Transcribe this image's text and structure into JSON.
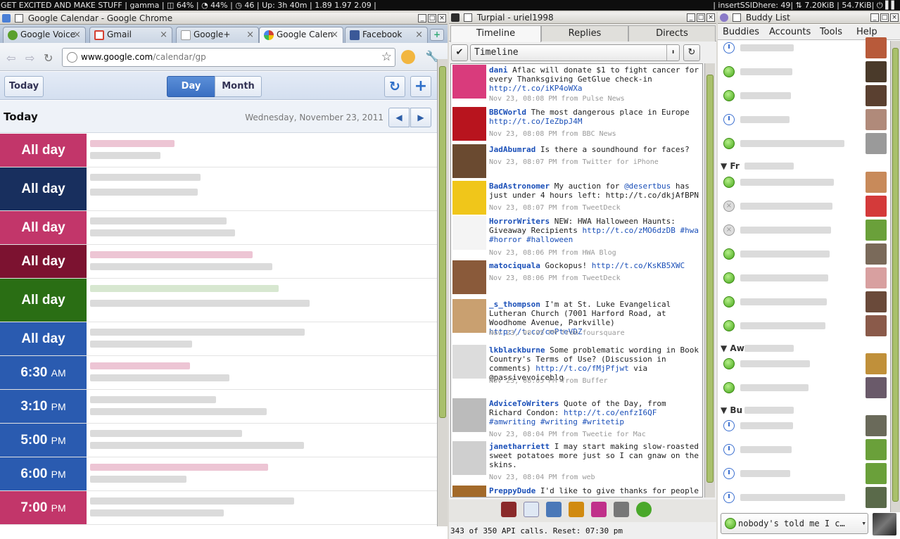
{
  "statusbar": {
    "left": "GET EXCITED AND MAKE STUFF | gamma | ◫ 64% | ◔ 44% | ◷ 46 | Up: 3h 40m | 1.89 1.97 2.09 |",
    "right": "| insertSSIDhere: 49| ⇅ 7.20KiB | 54.7KiB| ⏻ ▌▌"
  },
  "chrome": {
    "window_title": "Google Calendar - Google Chrome",
    "tabs": [
      {
        "label": "Google Voice",
        "color": "#5aa02c"
      },
      {
        "label": "Gmail",
        "color": "#d44032"
      },
      {
        "label": "Google+",
        "color": "#e6e6e6"
      },
      {
        "label": "Google Calen",
        "color": "#4a7fd6"
      },
      {
        "label": "Facebook",
        "color": "#3b5998"
      }
    ],
    "new_tab": "+",
    "url_host": "www.google.com",
    "url_path": "/calendar/gp"
  },
  "calendar": {
    "today_button": "Today",
    "day_button": "Day",
    "month_button": "Month",
    "refresh_glyph": "↻",
    "add_glyph": "+",
    "today_label": "Today",
    "date_label": "Wednesday, November 23, 2011",
    "prev_glyph": "◀",
    "next_glyph": "▶",
    "events": [
      {
        "time": "All day",
        "ampm": "",
        "color": "#c2366a",
        "height": 48
      },
      {
        "time": "All day",
        "ampm": "",
        "color": "#182f5e",
        "height": 62
      },
      {
        "time": "All day",
        "ampm": "",
        "color": "#c2366a",
        "height": 48
      },
      {
        "time": "All day",
        "ampm": "",
        "color": "#7c1230",
        "height": 48
      },
      {
        "time": "All day",
        "ampm": "",
        "color": "#2a6e14",
        "height": 62
      },
      {
        "time": "All day",
        "ampm": "",
        "color": "#2a5bb0",
        "height": 48
      },
      {
        "time": "6:30",
        "ampm": "AM",
        "color": "#2a5bb0",
        "height": 48
      },
      {
        "time": "3:10",
        "ampm": "PM",
        "color": "#2a5bb0",
        "height": 48
      },
      {
        "time": "5:00",
        "ampm": "PM",
        "color": "#2a5bb0",
        "height": 48
      },
      {
        "time": "6:00",
        "ampm": "PM",
        "color": "#2a5bb0",
        "height": 48
      },
      {
        "time": "7:00",
        "ampm": "PM",
        "color": "#c2366a",
        "height": 48
      }
    ]
  },
  "turpial": {
    "window_title": "Turpial - uriel1998",
    "tabs": [
      "Timeline",
      "Replies",
      "Directs"
    ],
    "column_select": "Timeline",
    "status_line": "343 of 350 API calls. Reset: 07:30 pm",
    "tweets": [
      {
        "user": "dani",
        "pre": "Aflac will donate $1 to fight cancer for every Thanksgiving GetGlue check-in ",
        "link": "http://t.co/iKP4oWXa",
        "post": "",
        "meta": "Nov 23, 08:08 PM from Pulse News",
        "av": "#d93b7c"
      },
      {
        "user": "BBCWorld",
        "pre": "The most dangerous place in Europe ",
        "link": "http://t.co/IeZbpJ4M",
        "post": "",
        "meta": "Nov 23, 08:08 PM from BBC News",
        "av": "#b8141e"
      },
      {
        "user": "JadAbumrad",
        "pre": "Is there a soundhound for faces?",
        "link": "",
        "post": "",
        "meta": "Nov 23, 08:07 PM from Twitter for iPhone",
        "av": "#6a4a30"
      },
      {
        "user": "BadAstronomer",
        "pre": "My auction for ",
        "link": "@desertbus",
        "post": " has just under 4 hours left: http://t.co/dkjAfBPN",
        "meta": "Nov 23, 08:07 PM from TweetDeck",
        "av": "#f0c61a"
      },
      {
        "user": "HorrorWriters",
        "pre": "NEW: HWA Halloween Haunts: Giveaway Recipients ",
        "link": "http://t.co/zMO6dzDB #hwa #horror #halloween",
        "post": "",
        "meta": "Nov 23, 08:06 PM from HWA Blog",
        "av": "#f4f4f4"
      },
      {
        "user": "matociquala",
        "pre": "Gockopus! ",
        "link": "http://t.co/KsKB5XWC",
        "post": "",
        "meta": "Nov 23, 08:06 PM from TweetDeck",
        "av": "#8a5a3a"
      },
      {
        "user": "_s_thompson",
        "pre": "I'm at St. Luke Evangelical Lutheran Church (7001 Harford Road, at Woodhome Avenue, Parkville) ",
        "link": "http://t.co/coPteVDZ",
        "post": "",
        "meta": "Nov 23, 08:05 PM from foursquare",
        "av": "#c9a070"
      },
      {
        "user": "lkblackburne",
        "pre": "Some problematic wording in Book Country's Terms of Use? (Discussion in comments) ",
        "link": "http://t.co/fMjPfjwt",
        "post": " via @passivevoiceblg",
        "meta": "Nov 23, 08:05 PM from Buffer",
        "av": "#dcdcdc"
      },
      {
        "user": "AdviceToWriters",
        "pre": "Quote of the Day, from Richard Condon: ",
        "link": "http://t.co/enfzI6QF #amwriting #writing #writetip",
        "post": "",
        "meta": "Nov 23, 08:04 PM from Tweetie for Mac",
        "av": "#bbbbbb"
      },
      {
        "user": "janetharriett",
        "pre": "I may start making slow-roasted sweet potatoes more just so I can gnaw on the skins.",
        "link": "",
        "post": "",
        "meta": "Nov 23, 08:04 PM from web",
        "av": "#cfcfcf"
      },
      {
        "user": "PreppyDude",
        "pre": "I'd like to give thanks for people who are actually funny as opposed to the hordes",
        "link": "",
        "post": "",
        "meta": "",
        "av": "#a36a2a"
      }
    ]
  },
  "buddy": {
    "window_title": "Buddy List",
    "menu": [
      "Buddies",
      "Accounts",
      "Tools",
      "Help"
    ],
    "groups": [
      "Fr",
      "Aw",
      "Bu"
    ],
    "status_message": "nobody's told me I c…"
  }
}
